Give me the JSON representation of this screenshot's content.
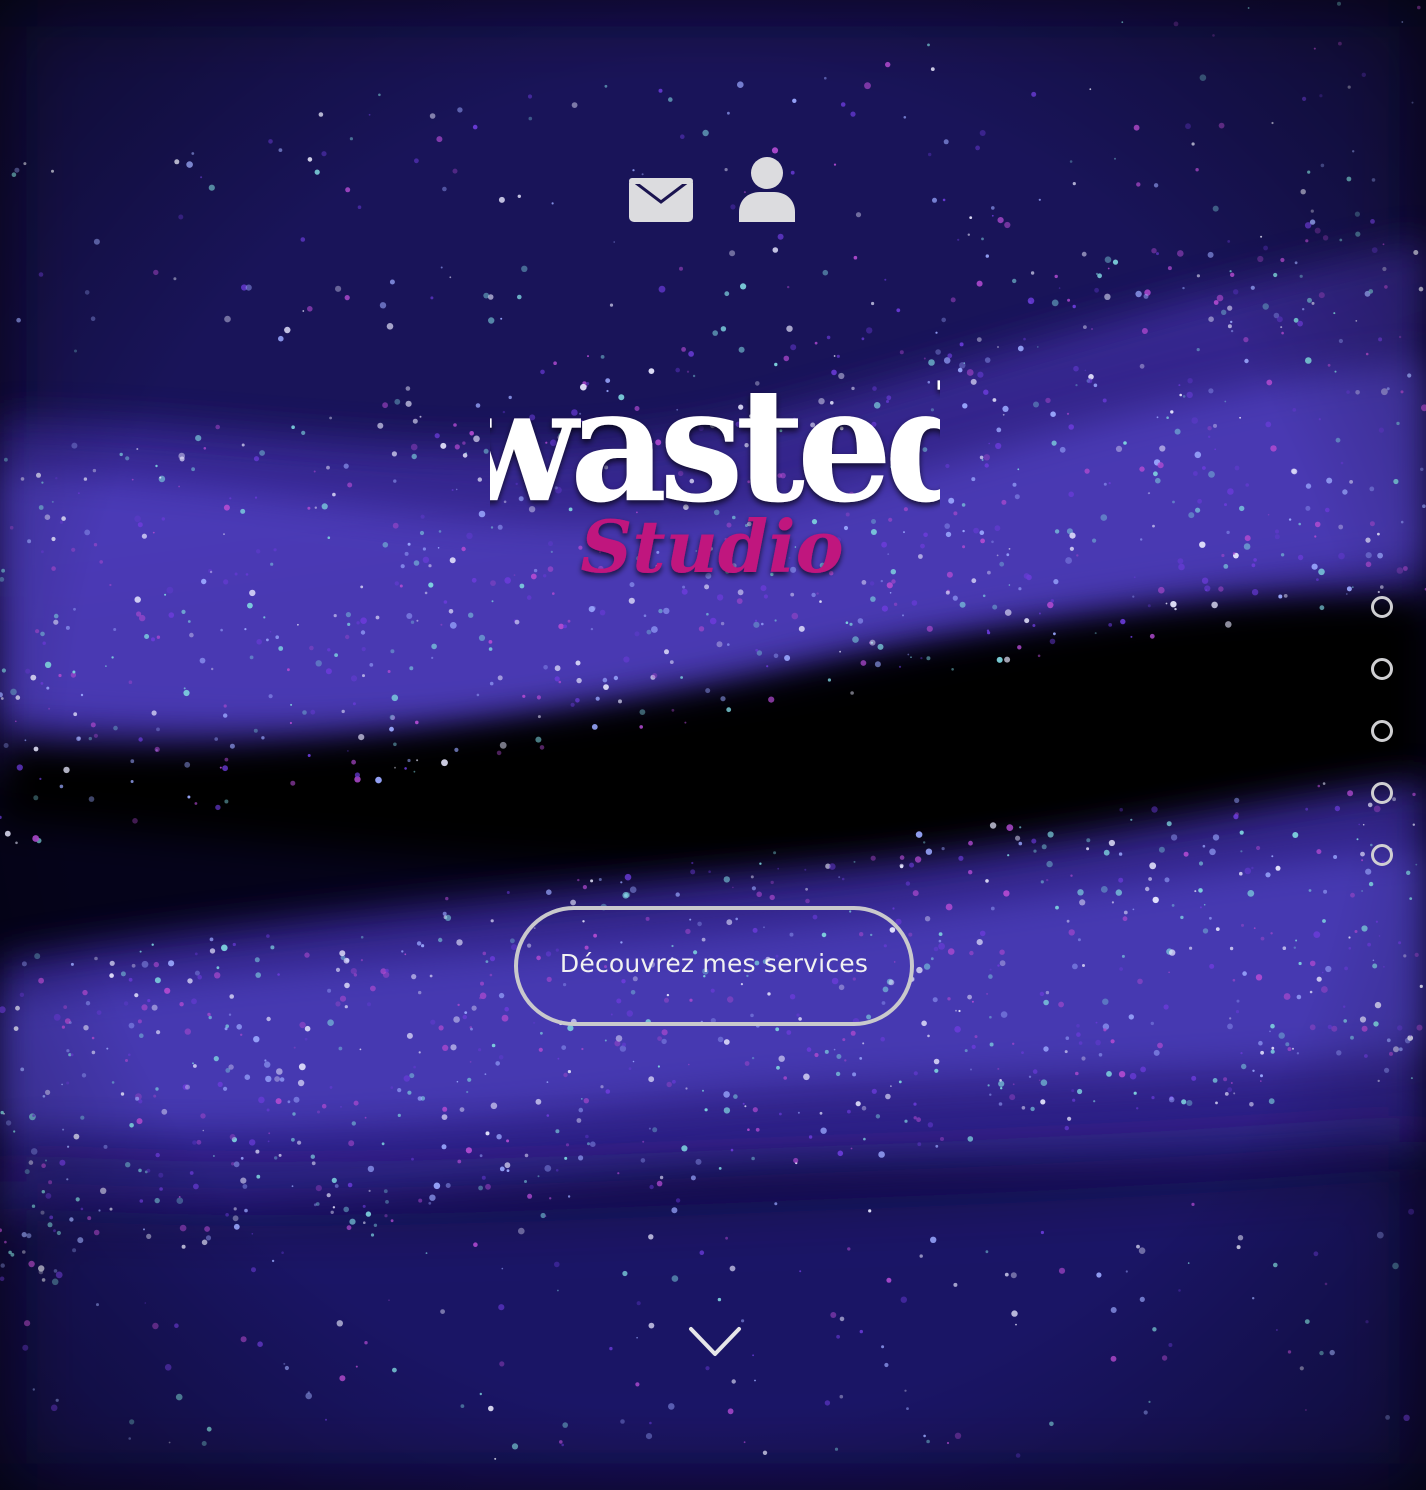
{
  "header": {
    "icons": [
      {
        "name": "envelope-icon",
        "color": "#dcdcdf"
      },
      {
        "name": "user-icon",
        "color": "#dcdcdf"
      }
    ]
  },
  "logo": {
    "line1": "wasted",
    "line2": "Studio",
    "line1_color": "#ffffff",
    "line2_color": "#c0127e"
  },
  "cta": {
    "label": "Découvrez mes services"
  },
  "section_nav": {
    "count": 5,
    "active_index": null
  },
  "scroll_hint": {
    "icon": "chevron-down-icon"
  },
  "colors": {
    "background": "#04020e",
    "particles_purple": "#6a3bd8",
    "particles_cyan": "#7fd6e0",
    "particles_magenta": "#b04ad0"
  }
}
